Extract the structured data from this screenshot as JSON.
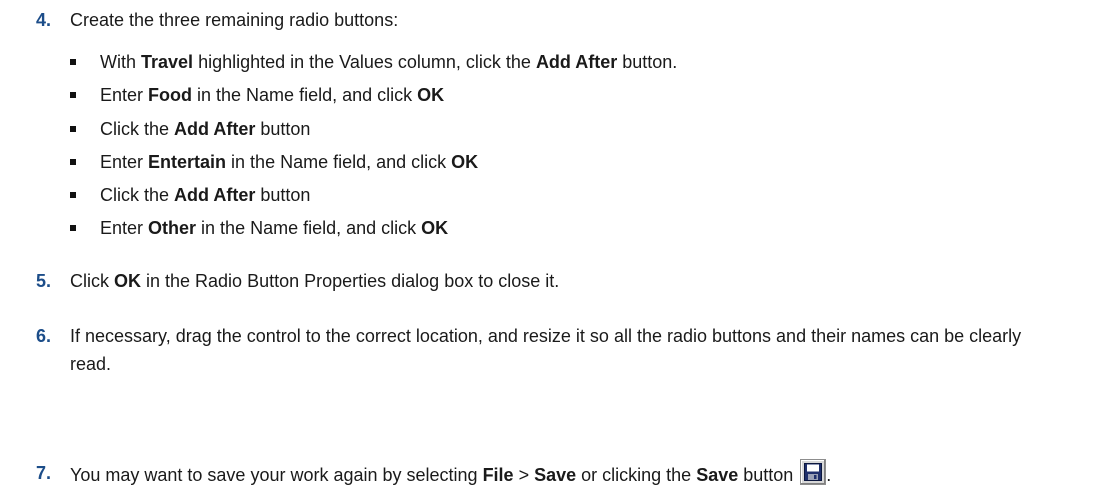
{
  "step4": {
    "num": "4.",
    "text": "Create the three remaining radio buttons:",
    "bullets": [
      {
        "parts": [
          {
            "t": "With ",
            "b": false
          },
          {
            "t": "Travel",
            "b": true
          },
          {
            "t": " highlighted in the Values column, click the ",
            "b": false
          },
          {
            "t": "Add After",
            "b": true
          },
          {
            "t": " button.",
            "b": false
          }
        ]
      },
      {
        "parts": [
          {
            "t": "Enter ",
            "b": false
          },
          {
            "t": "Food",
            "b": true
          },
          {
            "t": " in the Name field, and click ",
            "b": false
          },
          {
            "t": "OK",
            "b": true
          }
        ]
      },
      {
        "parts": [
          {
            "t": "Click the ",
            "b": false
          },
          {
            "t": "Add After",
            "b": true
          },
          {
            "t": " button",
            "b": false
          }
        ]
      },
      {
        "parts": [
          {
            "t": "Enter ",
            "b": false
          },
          {
            "t": "Entertain",
            "b": true
          },
          {
            "t": " in the Name field, and click ",
            "b": false
          },
          {
            "t": "OK",
            "b": true
          }
        ]
      },
      {
        "parts": [
          {
            "t": "Click the ",
            "b": false
          },
          {
            "t": "Add After",
            "b": true
          },
          {
            "t": " button",
            "b": false
          }
        ]
      },
      {
        "parts": [
          {
            "t": "Enter ",
            "b": false
          },
          {
            "t": "Other",
            "b": true
          },
          {
            "t": " in the Name field, and click ",
            "b": false
          },
          {
            "t": "OK",
            "b": true
          }
        ]
      }
    ]
  },
  "step5": {
    "num": "5.",
    "t1": "Click ",
    "b1": "OK",
    "t2": " in the Radio Button Properties dialog box to close it."
  },
  "step6": {
    "num": "6.",
    "text": "If necessary, drag the control to the correct location, and resize it so all the radio buttons and their names can be clearly read."
  },
  "step7": {
    "num": "7.",
    "t1": "You may want to save your work again by selecting ",
    "b1": "File",
    "t2": " > ",
    "b2": "Save",
    "t3": " or clicking the ",
    "b3": "Save",
    "t4": " button ",
    "t5": ".",
    "icon": "save-icon"
  },
  "colors": {
    "step_number": "#1c4d89",
    "text": "#1a1a1a"
  }
}
